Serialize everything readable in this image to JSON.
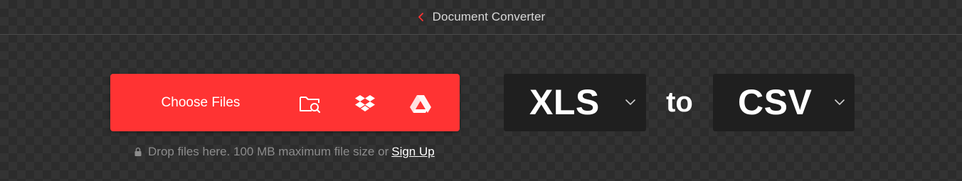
{
  "header": {
    "back_icon": "chevron-left-icon",
    "title": "Document Converter",
    "accent": "#ff3333"
  },
  "upload": {
    "choose_label": "Choose Files",
    "sources": [
      {
        "name": "folder-search-icon"
      },
      {
        "name": "dropbox-icon"
      },
      {
        "name": "google-drive-icon"
      }
    ],
    "button_color": "#ff3333"
  },
  "hint": {
    "lock_icon": "lock-icon",
    "text": "Drop files here. 100 MB maximum file size or",
    "signup_label": "Sign Up"
  },
  "conversion": {
    "from_format": "XLS",
    "connector": "to",
    "to_format": "CSV"
  }
}
